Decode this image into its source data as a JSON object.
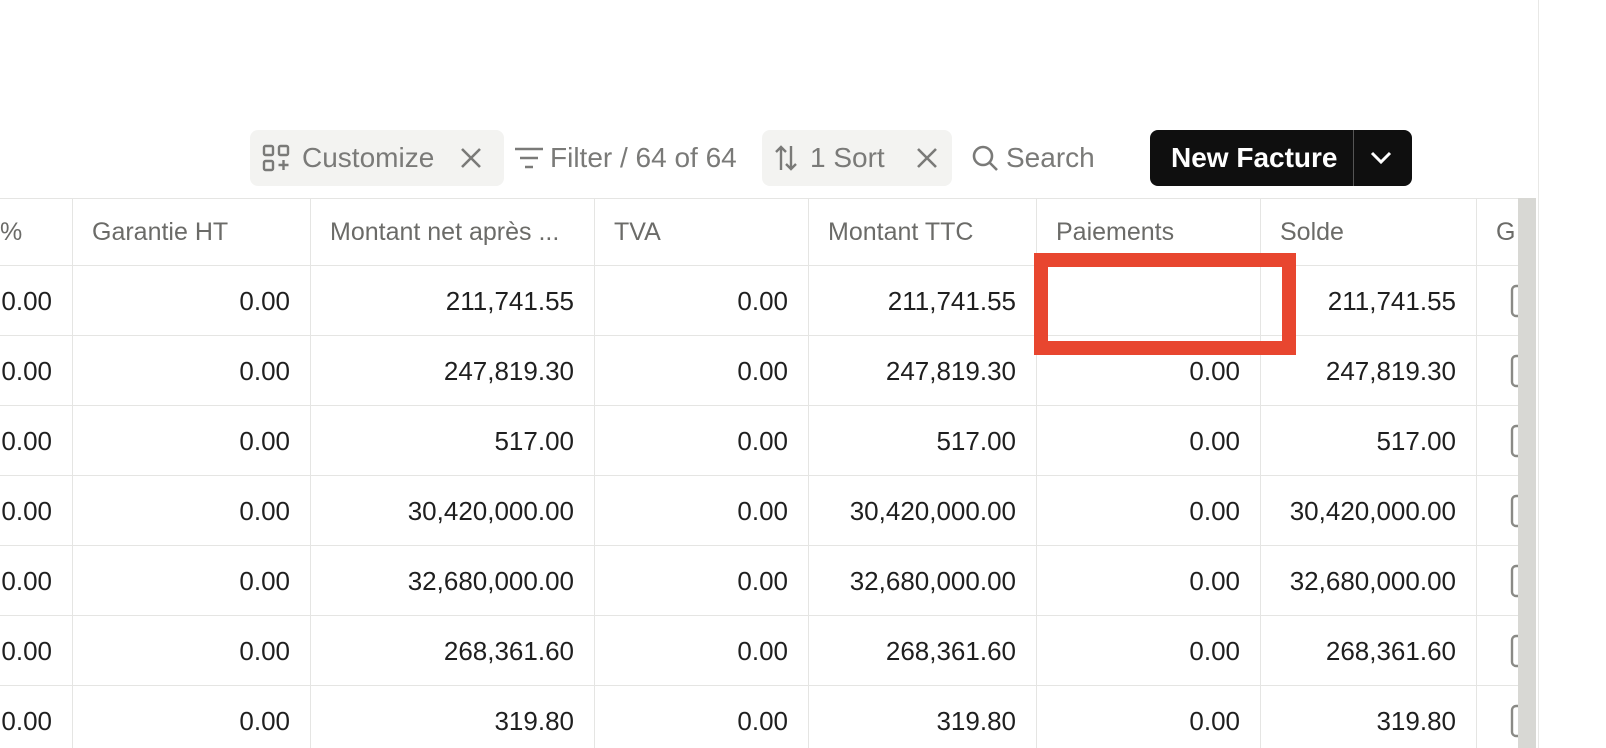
{
  "toolbar": {
    "customize_label": "Customize",
    "filter_label": "Filter / 64 of 64",
    "sort_label": "1 Sort",
    "search_label": "Search",
    "new_button_label": "New Facture"
  },
  "table": {
    "columns": [
      "%",
      "Garantie HT",
      "Montant net après ...",
      "TVA",
      "Montant TTC",
      "Paiements",
      "Solde",
      "G"
    ],
    "rows": [
      [
        "0.00",
        "0.00",
        "211,741.55",
        "0.00",
        "211,741.55",
        "",
        "211,741.55"
      ],
      [
        "0.00",
        "0.00",
        "247,819.30",
        "0.00",
        "247,819.30",
        "0.00",
        "247,819.30"
      ],
      [
        "0.00",
        "0.00",
        "517.00",
        "0.00",
        "517.00",
        "0.00",
        "517.00"
      ],
      [
        "0.00",
        "0.00",
        "30,420,000.00",
        "0.00",
        "30,420,000.00",
        "0.00",
        "30,420,000.00"
      ],
      [
        "0.00",
        "0.00",
        "32,680,000.00",
        "0.00",
        "32,680,000.00",
        "0.00",
        "32,680,000.00"
      ],
      [
        "0.00",
        "0.00",
        "268,361.60",
        "0.00",
        "268,361.60",
        "0.00",
        "268,361.60"
      ],
      [
        "0.00",
        "0.00",
        "319.80",
        "0.00",
        "319.80",
        "0.00",
        "319.80"
      ]
    ]
  },
  "colors": {
    "highlight": "#e8462f",
    "button": "#0f0f0f",
    "chip_bg": "#f3f3f1"
  }
}
